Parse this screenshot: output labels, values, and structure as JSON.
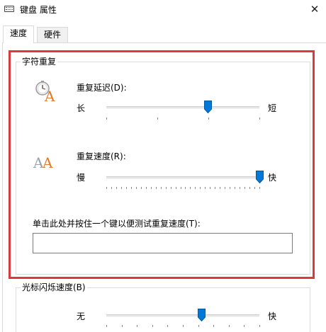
{
  "window": {
    "title": "键盘 属性",
    "close_symbol": "✕"
  },
  "tabs": [
    {
      "label": "速度",
      "active": true
    },
    {
      "label": "硬件",
      "active": false
    }
  ],
  "char_repeat": {
    "legend": "字符重复",
    "delay": {
      "label": "重复延迟(D):",
      "min_label": "长",
      "max_label": "短",
      "value_fraction": 0.66,
      "tick_count": 4,
      "icon": "clock-letter-icon"
    },
    "rate": {
      "label": "重复速度(R):",
      "min_label": "慢",
      "max_label": "快",
      "value_fraction": 1.0,
      "tick_count": 32,
      "icon": "double-letter-icon"
    },
    "test": {
      "label": "单击此处并按住一个键以便测试重复速度(T):",
      "value": ""
    }
  },
  "cursor_blink": {
    "legend": "光标闪烁速度(B)",
    "min_label": "无",
    "max_label": "快",
    "value_fraction": 0.62,
    "tick_count": 11
  },
  "colors": {
    "highlight": "#d9393f",
    "accent": "#0078d7"
  }
}
